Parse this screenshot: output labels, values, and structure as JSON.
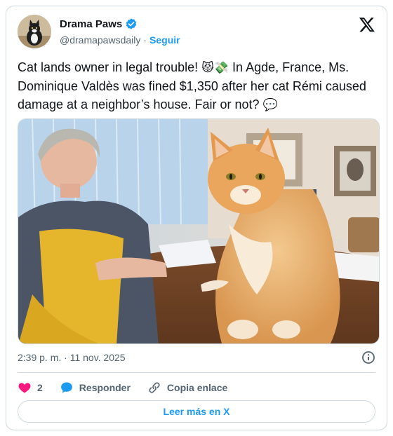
{
  "author": {
    "display_name": "Drama Paws",
    "handle": "@dramapawsdaily",
    "separator": "·",
    "follow_label": "Seguir",
    "verified": true
  },
  "post": {
    "text_part1": "Cat lands owner in legal trouble! ",
    "emoji1": "😾💸",
    "text_part2": " In Agde, France, Ms. Dominique Valdès was fined $1,350 after her cat Rémi caused damage at a neighbor’s house. Fair or not? ",
    "emoji2": "💬",
    "timestamp": "2:39 p. m. · 11 nov. 2025"
  },
  "actions": {
    "like_count": "2",
    "reply_label": "Responder",
    "copy_label": "Copia enlace"
  },
  "footer": {
    "read_more_label": "Leer más en X"
  },
  "colors": {
    "accent": "#1d9bf0",
    "like": "#f91880",
    "text": "#0f1419",
    "secondary": "#536471"
  },
  "icons": {
    "verified": "verified-badge-icon",
    "platform": "x-logo-icon",
    "info": "info-icon",
    "like": "heart-icon",
    "reply": "reply-bubble-icon",
    "copy": "link-icon"
  }
}
